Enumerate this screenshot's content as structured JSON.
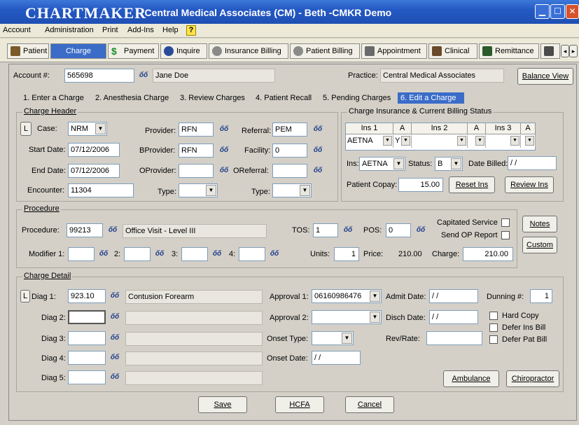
{
  "window": {
    "app_name": "CHARTMAKER",
    "title": "- Central Medical Associates (CM) - Beth -CMKR Demo",
    "min": "▁",
    "max": "☐",
    "close": "✕"
  },
  "menu": [
    "Account",
    "Administration",
    "Print",
    "Add-Ins",
    "Help"
  ],
  "help_icon": "?",
  "tabs": [
    {
      "label": "Patient",
      "icon": "patient-icon",
      "color": "#7a5a2a"
    },
    {
      "label": "Charge",
      "icon": "",
      "color": "#3a6cc8"
    },
    {
      "label": "Payment",
      "icon": "dollar-icon",
      "color": "#1d8c2a"
    },
    {
      "label": "Inquire",
      "icon": "inquire-icon",
      "color": "#2a4a9a"
    },
    {
      "label": "Insurance Billing",
      "icon": "insurance-icon",
      "color": "#6a6a6a"
    },
    {
      "label": "Patient Billing",
      "icon": "billing-icon",
      "color": "#6a6a6a"
    },
    {
      "label": "Appointment",
      "icon": "calendar-icon",
      "color": "#5a5a5a"
    },
    {
      "label": "Clinical",
      "icon": "clinical-icon",
      "color": "#6a4a2a"
    },
    {
      "label": "Remittance",
      "icon": "remittance-icon",
      "color": "#2a5a2a"
    },
    {
      "label": "",
      "icon": "print-icon",
      "color": "#4a4a4a"
    }
  ],
  "scroll_left": "◂",
  "scroll_right": "▸",
  "account": {
    "label": "Account #:",
    "value": "565698",
    "name": "Jane Doe",
    "practice_label": "Practice:",
    "practice": "Central Medical Associates",
    "balance_btn": "Balance View"
  },
  "subtabs": [
    "1. Enter a Charge",
    "2. Anesthesia Charge",
    "3. Review Charges",
    "4. Patient Recall",
    "5. Pending Charges",
    "6. Edit a Charge"
  ],
  "header": {
    "title": "Charge Header",
    "l": "L",
    "case_label": "Case:",
    "case": "NRM",
    "start_label": "Start Date:",
    "start": "07/12/2006",
    "end_label": "End Date:",
    "end": "07/12/2006",
    "enc_label": "Encounter:",
    "enc": "11304",
    "provider_label": "Provider:",
    "provider": "RFN",
    "bprovider_label": "BProvider:",
    "bprovider": "RFN",
    "oprovider_label": "OProvider:",
    "oprovider": "",
    "type_label": "Type:",
    "type": "",
    "referral_label": "Referral:",
    "referral": "PEM",
    "facility_label": "Facility:",
    "facility": "0",
    "oreferral_label": "OReferral:",
    "oreferral": "",
    "type2_label": "Type:",
    "type2": ""
  },
  "ins": {
    "title": "Charge Insurance & Current Billing Status",
    "cols": [
      "Ins 1",
      "A",
      "Ins 2",
      "A",
      "Ins 3",
      "A"
    ],
    "row": [
      "AETNA",
      "Y",
      "",
      "",
      "",
      ""
    ],
    "ins_label": "Ins:",
    "ins": "AETNA",
    "status_label": "Status:",
    "status": "B",
    "billed_label": "Date Billed:",
    "billed": "/ /",
    "copay_label": "Patient Copay:",
    "copay": "15.00",
    "reset": "Reset Ins",
    "review": "Review Ins"
  },
  "procedure": {
    "title": "Procedure",
    "proc_label": "Procedure:",
    "code": "99213",
    "desc": "Office Visit - Level III",
    "tos_label": "TOS:",
    "tos": "1",
    "pos_label": "POS:",
    "pos": "0",
    "capitated": "Capitated Service",
    "send_op": "Send OP Report",
    "notes": "Notes",
    "custom": "Custom",
    "mod1": "Modifier 1:",
    "m2": "2:",
    "m3": "3:",
    "m4": "4:",
    "units_label": "Units:",
    "units": "1",
    "price_label": "Price:",
    "price": "210.00",
    "charge_label": "Charge:",
    "charge": "210.00"
  },
  "detail": {
    "title": "Charge Detail",
    "l": "L",
    "d1": "Diag 1:",
    "d1v": "923.10",
    "d1desc": "Contusion Forearm",
    "d2": "Diag 2:",
    "d3": "Diag 3:",
    "d4": "Diag 4:",
    "d5": "Diag 5:",
    "a1": "Approval 1:",
    "a1v": "06160986476",
    "a2": "Approval 2:",
    "onset_type": "Onset Type:",
    "onset_date": "Onset Date:",
    "onset_date_v": "/ /",
    "admit": "Admit Date:",
    "admit_v": "/ /",
    "disch": "Disch Date:",
    "disch_v": "/ /",
    "rev": "Rev/Rate:",
    "dunning": "Dunning #:",
    "dunning_v": "1",
    "hard": "Hard Copy",
    "defer_ins": "Defer Ins Bill",
    "defer_pat": "Defer Pat Bill",
    "ambulance": "Ambulance",
    "chiro": "Chiropractor"
  },
  "footer": {
    "save": "Save",
    "hcfa": "HCFA",
    "cancel": "Cancel"
  },
  "binoc": "ốố"
}
